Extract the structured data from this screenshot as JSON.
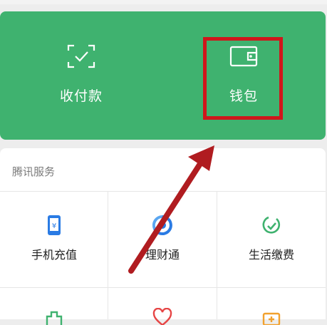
{
  "wallet_panel": {
    "actions": [
      {
        "label": "收付款",
        "icon": "scan-pay-icon"
      },
      {
        "label": "钱包",
        "icon": "wallet-icon"
      }
    ]
  },
  "services": {
    "title": "腾讯服务",
    "items": [
      {
        "label": "手机充值",
        "icon": "mobile-topup-icon",
        "color": "#2a7be4"
      },
      {
        "label": "理财通",
        "icon": "wealth-icon",
        "color": "#2a7be4"
      },
      {
        "label": "生活缴费",
        "icon": "utility-bill-icon",
        "color": "#3fb26f"
      }
    ],
    "row2_icons": [
      "city-services-icon",
      "charity-icon",
      "medical-icon"
    ]
  },
  "annotation": {
    "highlight_color": "#d0161b",
    "arrow_color": "#b01c20"
  }
}
